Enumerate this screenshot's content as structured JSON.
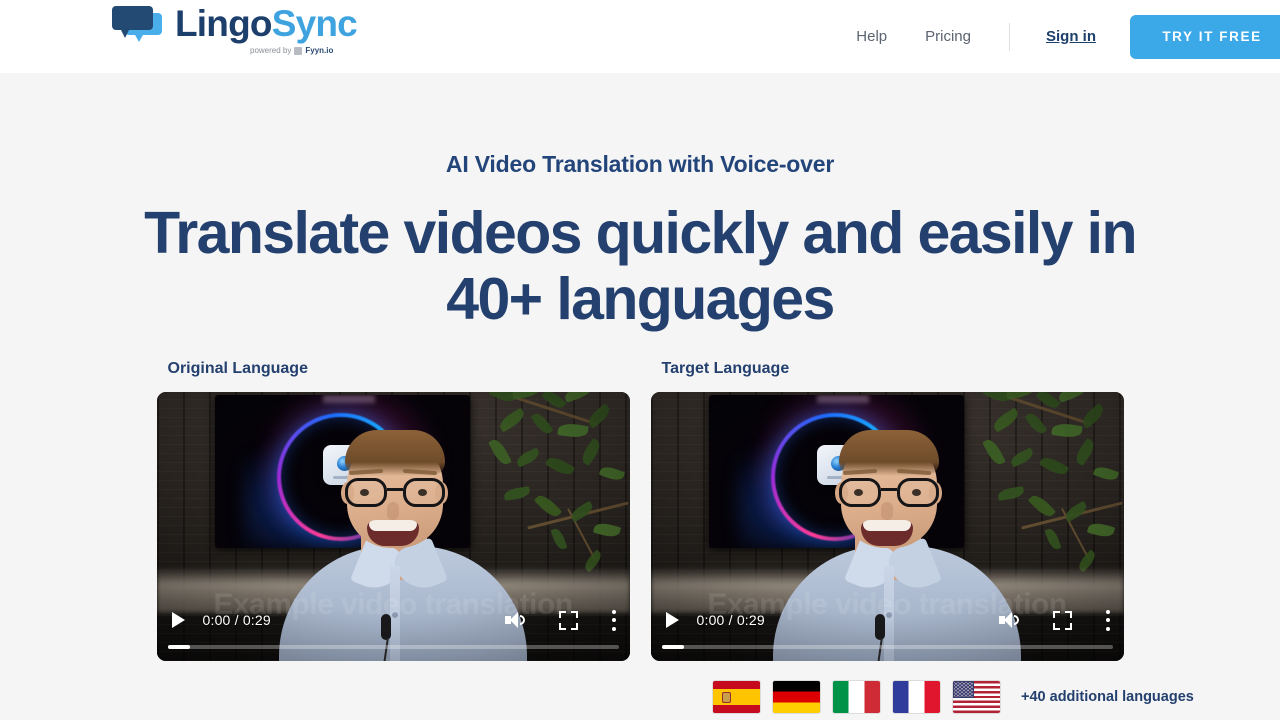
{
  "brand": {
    "name_part1": "Lingo",
    "name_part2": "Sync",
    "powered_prefix": "powered by",
    "powered_by": "Fyyn.io",
    "logo_icon": "speech-bubbles-icon",
    "color_navy": "#1d3f6b",
    "color_blue": "#3fa3e0"
  },
  "nav": {
    "links": [
      {
        "label": "Help"
      },
      {
        "label": "Pricing"
      }
    ],
    "sign_in": "Sign in",
    "cta": "TRY IT FREE",
    "cta_color": "#3ba8e8"
  },
  "hero": {
    "eyebrow": "AI Video Translation with Voice-over",
    "headline": "Translate videos quickly and easily in 40+ languages",
    "heading_color": "#24406e"
  },
  "videos": [
    {
      "label": "Original Language",
      "watermark": "Example video translation",
      "controls": {
        "play": "play-icon",
        "time": "0:00 / 0:29",
        "volume": "volume-icon",
        "fullscreen": "fullscreen-icon",
        "menu": "more-vertical-icon"
      }
    },
    {
      "label": "Target Language",
      "watermark": "Example video translation",
      "controls": {
        "play": "play-icon",
        "time": "0:00 / 0:29",
        "volume": "volume-icon",
        "fullscreen": "fullscreen-icon",
        "menu": "more-vertical-icon"
      }
    }
  ],
  "languages": {
    "flags": [
      {
        "code": "es",
        "name": "Spain"
      },
      {
        "code": "de",
        "name": "Germany"
      },
      {
        "code": "it",
        "name": "Italy"
      },
      {
        "code": "fr",
        "name": "France"
      },
      {
        "code": "us",
        "name": "United States"
      }
    ],
    "note": "+40 additional languages"
  }
}
